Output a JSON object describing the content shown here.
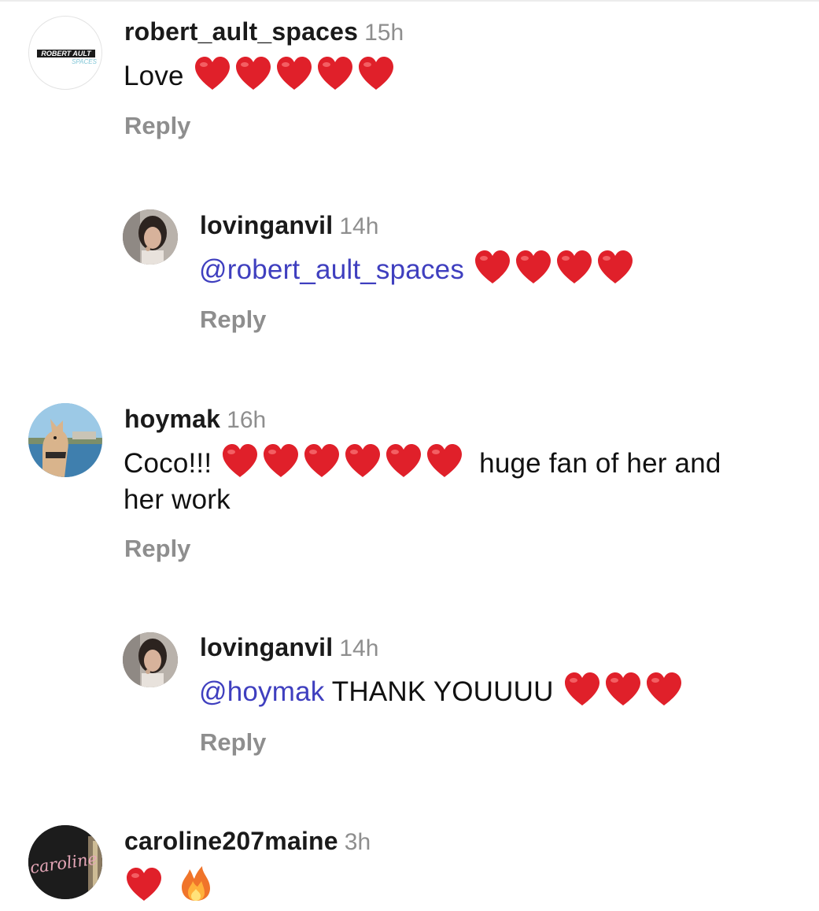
{
  "comments": [
    {
      "username": "robert_ault_spaces",
      "time": "15h",
      "text": "Love",
      "emojis": [
        "red-heart",
        "red-heart",
        "red-heart",
        "red-heart",
        "red-heart"
      ],
      "reply_label": "Reply",
      "avatar_logo": {
        "line1": "ROBERT AULT",
        "line2": "SPACES"
      }
    },
    {
      "username": "lovinganvil",
      "time": "14h",
      "mention": "@robert_ault_spaces",
      "emojis": [
        "red-heart",
        "red-heart",
        "red-heart",
        "red-heart"
      ],
      "reply_label": "Reply"
    },
    {
      "username": "hoymak",
      "time": "16h",
      "text_before": "Coco!!!",
      "emojis": [
        "red-heart",
        "red-heart",
        "red-heart",
        "red-heart",
        "red-heart",
        "red-heart"
      ],
      "text_after_line1": "huge fan of her and",
      "text_line2": "her work",
      "reply_label": "Reply"
    },
    {
      "username": "lovinganvil",
      "time": "14h",
      "mention": "@hoymak",
      "text": "THANK YOUUUU",
      "emojis": [
        "red-heart",
        "red-heart",
        "red-heart"
      ],
      "reply_label": "Reply"
    },
    {
      "username": "caroline207maine",
      "time": "3h",
      "emojis": [
        "red-heart",
        "fire"
      ],
      "avatar_logo": {
        "line1": "caroline"
      }
    }
  ],
  "colors": {
    "username": "#1a1a1a",
    "timestamp": "#8e8e8e",
    "mention": "#3f3fbf",
    "heart": "#e0202a"
  }
}
